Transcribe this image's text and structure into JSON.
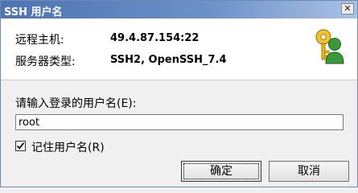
{
  "window": {
    "title": "SSH 用户名",
    "close_symbol": "✕"
  },
  "info": {
    "host_label": "远程主机:",
    "host_value": "49.4.87.154:22",
    "server_type_label": "服务器类型:",
    "server_type_value": "SSH2, OpenSSH_7.4",
    "icon": "keys-icon"
  },
  "form": {
    "prompt_label": "请输入登录的用户名(E):",
    "username_value": "root",
    "remember_checked": true,
    "remember_label": "记住用户名(R)"
  },
  "buttons": {
    "ok_label": "确定",
    "cancel_label": "取消"
  }
}
